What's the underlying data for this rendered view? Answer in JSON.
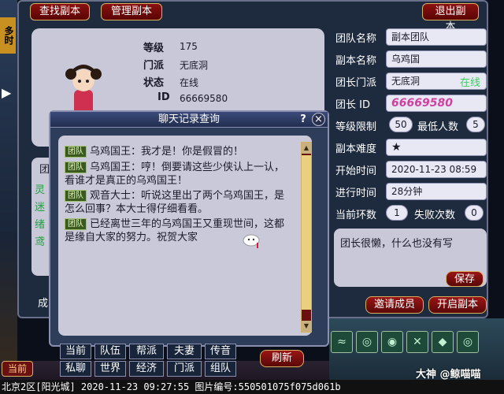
{
  "top_buttons": {
    "find": "查找副本",
    "manage": "管理副本",
    "exit": "退出副本"
  },
  "character": {
    "level_label": "等级",
    "level": "175",
    "faction_label": "门派",
    "faction": "无底洞",
    "status_label": "状态",
    "status": "在线",
    "id_label": "ID",
    "id": "66669580"
  },
  "dungeon": {
    "team_name_label": "团队名称",
    "team_name": "副本团队",
    "dungeon_name_label": "副本名称",
    "dungeon_name": "乌鸡国",
    "leader_faction_label": "团长门派",
    "leader_faction": "无底洞",
    "leader_online": "在线",
    "leader_id_label": "团长 ID",
    "leader_id": "66669580",
    "level_limit_label": "等级限制",
    "level_limit": "50",
    "min_members_label": "最低人数",
    "min_members": "5",
    "difficulty_label": "副本难度",
    "difficulty_stars": "★",
    "start_time_label": "开始时间",
    "start_time": "2020-11-23 08:59",
    "elapsed_label": "进行时间",
    "elapsed": "28分钟",
    "round_label": "当前环数",
    "round": "1",
    "fail_label": "失败次数",
    "fail": "0",
    "note": "团长很懒，什么也没有写",
    "save_label": "保存",
    "invite_label": "邀请成员",
    "start_label": "开启副本"
  },
  "left_partial": {
    "team_fragment": "团",
    "lines": [
      "灵",
      "迷",
      "绪",
      "鸢"
    ],
    "bottom": "成"
  },
  "left_edge": {
    "top": "多时",
    "bottom_btn": "当前"
  },
  "chat": {
    "title": "聊天记录查询",
    "help": "?",
    "close": "×",
    "messages": [
      {
        "tag": "团队",
        "text": "乌鸡国王：我才是！你是假冒的！"
      },
      {
        "tag": "团队",
        "text": "乌鸡国王：哼！倒要请这些少侠认上一认，看谁才是真正的乌鸡国王！"
      },
      {
        "tag": "团队",
        "text": "观音大士：听说这里出了两个乌鸡国王，是怎么回事？本大士得仔细看看。"
      },
      {
        "tag": "团队",
        "text": "已经离世三年的乌鸡国王又重现世间，这都是缘自大家的努力。祝贺大家"
      }
    ],
    "channels_row1": [
      "当前",
      "队伍",
      "帮派",
      "夫妻",
      "传音"
    ],
    "channels_row2": [
      "私聊",
      "世界",
      "经济",
      "门派",
      "组队"
    ],
    "refresh": "刷新"
  },
  "status_bar": "北京2区[阳光城] 2020-11-23 09:27:55 图片编号:550501075f075d061b",
  "watermark": "大神 @鲸喵喵",
  "colors": {
    "accent_red": "#8a1010",
    "gold_border": "#d8b060",
    "online_green": "#3ad060",
    "panel_gray": "#c8c8d8"
  }
}
